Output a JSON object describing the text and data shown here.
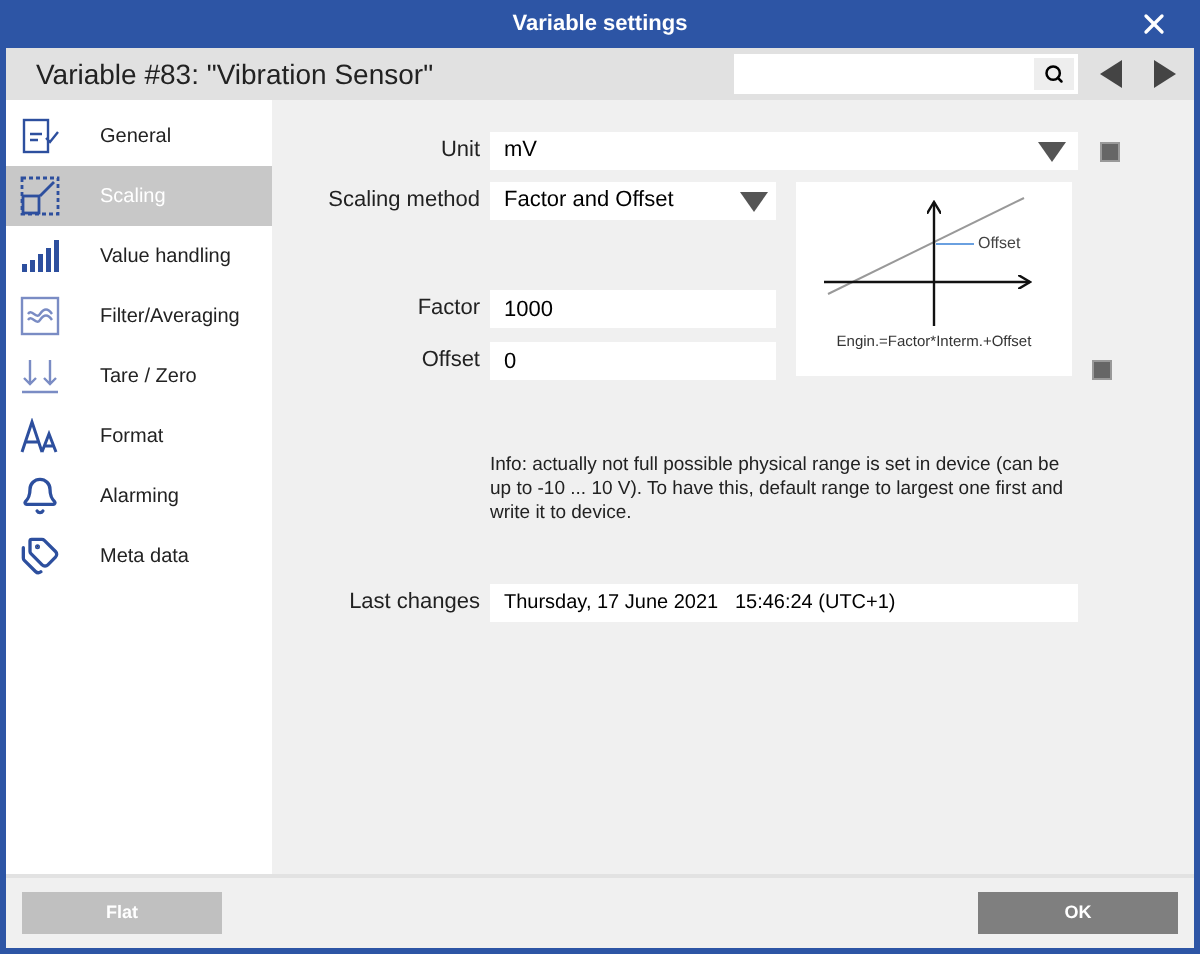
{
  "window": {
    "title": "Variable settings"
  },
  "header": {
    "title": "Variable #83: \"Vibration Sensor\""
  },
  "sidebar": {
    "items": [
      {
        "label": "General",
        "selected": false
      },
      {
        "label": "Scaling",
        "selected": true
      },
      {
        "label": "Value handling",
        "selected": false
      },
      {
        "label": "Filter/Averaging",
        "selected": false
      },
      {
        "label": "Tare / Zero",
        "selected": false
      },
      {
        "label": "Format",
        "selected": false
      },
      {
        "label": "Alarming",
        "selected": false
      },
      {
        "label": "Meta data",
        "selected": false
      }
    ]
  },
  "form": {
    "unit": {
      "label": "Unit",
      "value": "mV"
    },
    "scaling_method": {
      "label": "Scaling method",
      "value": "Factor and Offset"
    },
    "factor": {
      "label": "Factor",
      "value": "1000"
    },
    "offset": {
      "label": "Offset",
      "value": "0"
    },
    "diagram": {
      "offset_label": "Offset",
      "formula": "Engin.=Factor*Interm.+Offset"
    },
    "info": "Info: actually not full possible physical range is set in device (can be up to -10 ... 10 V). To have this, default range to largest one first and write it to device.",
    "last_changes": {
      "label": "Last changes",
      "value": "Thursday, 17 June 2021   15:46:24 (UTC+1)"
    }
  },
  "buttons": [
    {
      "label": "Flat",
      "disabled": true
    },
    {
      "label": "OK",
      "disabled": false
    }
  ]
}
